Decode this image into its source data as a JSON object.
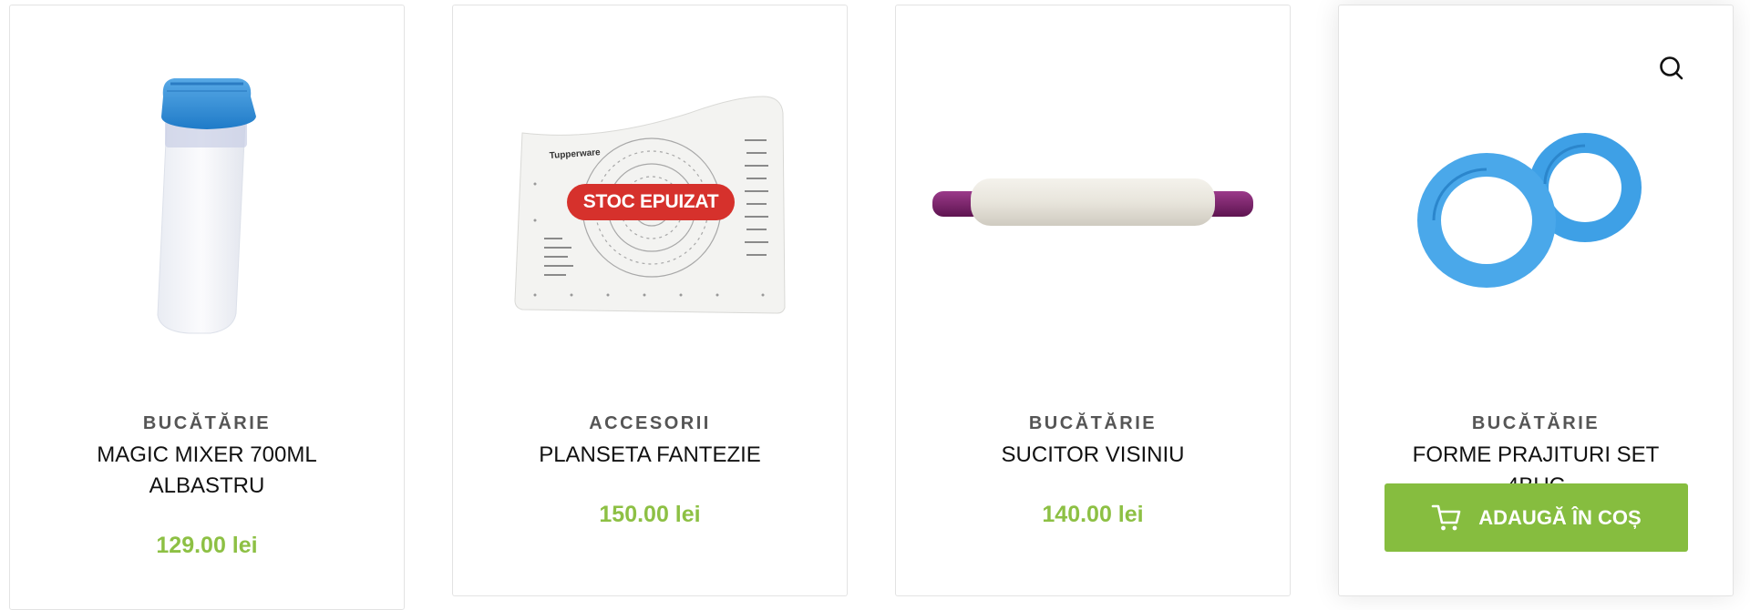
{
  "colors": {
    "category": "#555555",
    "price": "#8dc044",
    "badge": "#d6312c",
    "add_button": "#86bd3f"
  },
  "products": [
    {
      "category": "BUCĂTĂRIE",
      "title": "MAGIC MIXER 700ML ALBASTRU",
      "price": "129.00 lei",
      "image_icon": "blue-shaker-bottle-image"
    },
    {
      "category": "ACCESORII",
      "title": "PLANSETA FANTEZIE",
      "price": "150.00 lei",
      "badge": "STOC EPUIZAT",
      "image_icon": "pastry-mat-image",
      "image_text": "Tupperware"
    },
    {
      "category": "BUCĂTĂRIE",
      "title": "SUCITOR VISINIU",
      "price": "140.00 lei",
      "image_icon": "rolling-pin-image"
    },
    {
      "category": "BUCĂTĂRIE",
      "title": "FORME PRAJITURI SET 4BUC",
      "add_to_cart": "ADAUGĂ ÎN COȘ",
      "image_icon": "blue-cookie-cutter-rings-image",
      "search_icon": "search-icon",
      "cart_icon": "shopping-cart-icon"
    }
  ]
}
